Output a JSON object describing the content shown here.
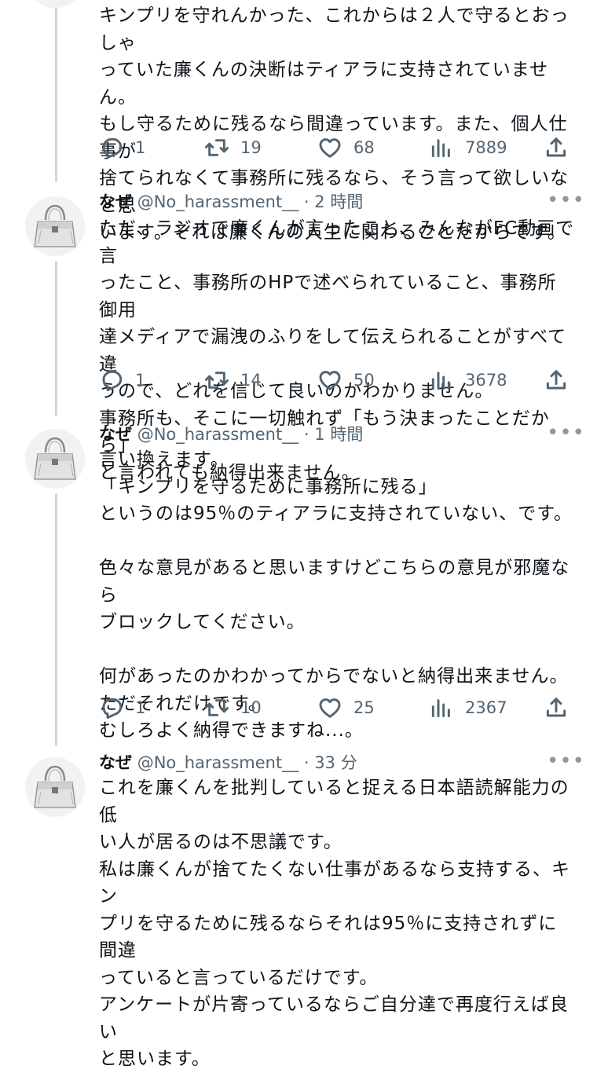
{
  "tweets": [
    {
      "text": "キンプリを守れんかった、これからは２人で守るとおっしゃ\nっていた廉くんの決断はティアラに支持されていません。\nもし守るために残るなら間違っています。また、個人仕事が\n捨てられなくて事務所に残るなら、そう言って欲しいなと思\nいます。それは廉くんの人生に関わることだからです。",
      "replies": "1",
      "retweets": "19",
      "likes": "68",
      "views": "7889"
    },
    {
      "name": "なぜ",
      "handle": "@No_harassment__",
      "separator": "·",
      "time": "2 時間",
      "text": "ただ、ラジオで廉くんが言ったこと、みんながFC動画で言\nったこと、事務所のHPで述べられていること、事務所御用\n達メディアで漏洩のふりをして伝えられることがすべて違\nうので、どれを信じて良いのかわかりません。\n事務所も、そこに一切触れず「もう決まったことだから」\nと言われても納得出来ません。",
      "replies": "1",
      "retweets": "14",
      "likes": "50",
      "views": "3678"
    },
    {
      "name": "なぜ",
      "handle": "@No_harassment__",
      "separator": "·",
      "time": "1 時間",
      "text": "言い換えます。\n「キンプリを守るために事務所に残る」\nというのは95％のティアラに支持されていない、です。\n\n色々な意見があると思いますけどこちらの意見が邪魔なら\nブロックしてください。\n\n何があったのかわかってからでないと納得出来ません。\nただそれだけです。\nむしろよく納得できますね...。",
      "replies": "1",
      "retweets": "10",
      "likes": "25",
      "views": "2367"
    },
    {
      "name": "なぜ",
      "handle": "@No_harassment__",
      "separator": "·",
      "time": "33 分",
      "text": "これを廉くんを批判していると捉える日本語読解能力の低\nい人が居るのは不思議です。\n私は廉くんが捨てたくない仕事があるなら支持する、キン\nプリを守るために残るならそれは95％に支持されずに間違\nっていると言っているだけです。\nアンケートが片寄っているならご自分達で再度行えば良い\nと思います。"
    }
  ],
  "icons": {
    "reply": "reply-icon",
    "retweet": "retweet-icon",
    "like": "heart-icon",
    "views": "views-icon",
    "share": "share-icon",
    "more": "more-icon",
    "avatar": "handbag-avatar"
  },
  "colors": {
    "text": "#0f1419",
    "muted": "#536471",
    "thread_line": "#cfd9de",
    "background": "#ffffff"
  }
}
